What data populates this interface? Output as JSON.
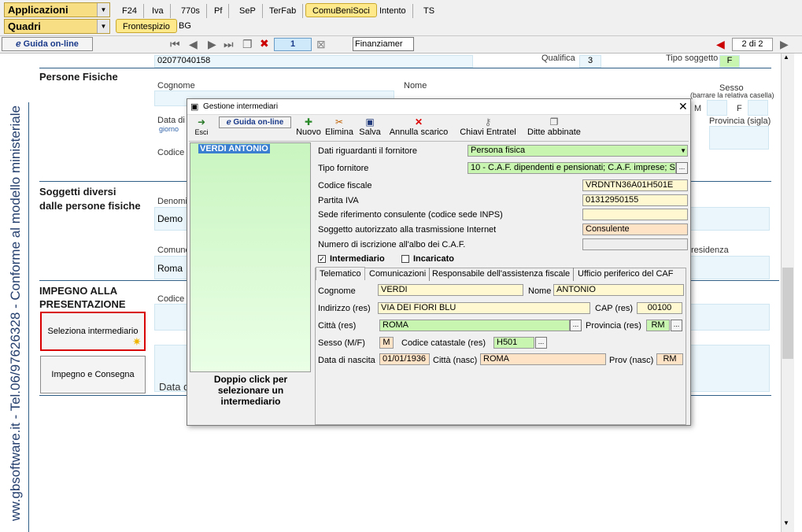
{
  "top": {
    "app_combo": "Applicazioni",
    "quadri_combo": "Quadri",
    "tabs": [
      "F24",
      "Iva",
      "770s",
      "Pf",
      "SeP",
      "TerFab",
      "ComuBeniSoci",
      "Intento",
      "TS"
    ],
    "subtabs": [
      "Frontespizio",
      "BG"
    ]
  },
  "nav": {
    "guida": "Guida on-line",
    "page_num": "1",
    "combo": "Finanziamer",
    "page_of": "2 di 2"
  },
  "form": {
    "vertical_text": "ww.gbsoftware.it - Tel.06/97626328 - Conforme al modello ministeriale",
    "codice_fiscale_val": "02077040158",
    "qualifica_lbl": "Qualifica",
    "qualifica_val": "3",
    "tipo_soggetto_lbl": "Tipo soggetto",
    "tipo_soggetto_val": "F",
    "persone_fisiche": "Persone Fisiche",
    "cognome": "Cognome",
    "nome": "Nome",
    "sesso": "Sesso",
    "sesso_hint": "(barrare la relativa casella)",
    "m": "M",
    "f": "F",
    "data_di": "Data di",
    "giorno": "giorno",
    "provincia_sigla": "Provincia (sigla)",
    "codice_s": "Codice S",
    "soggetti_diversi_1": "Soggetti diversi",
    "soggetti_diversi_2": "dalle persone fisiche",
    "denomin": "Denomin",
    "demo": "Demo",
    "comune": "Comune",
    "residenza": "residenza",
    "roma": "Roma",
    "impegno_1": "IMPEGNO ALLA",
    "impegno_2": "PRESENTAZIONE",
    "codice_f": "Codice F",
    "seleziona": "Seleziona intermediario",
    "impegno_consegna": "Impegno e Consegna",
    "data_c": "Data d"
  },
  "dialog": {
    "title": "Gestione intermediari",
    "toolbar": {
      "esci": "Esci",
      "guida": "Guida on-line",
      "nuovo": "Nuovo",
      "elimina": "Elimina",
      "salva": "Salva",
      "annulla": "Annulla scarico",
      "chiavi": "Chiavi Entratel",
      "ditte": "Ditte abbinate"
    },
    "list_item": "VERDI ANTONIO",
    "list_hint": "Doppio click per selezionare un intermediario",
    "fields": {
      "dati_fornitore_lbl": "Dati riguardanti il fornitore",
      "dati_fornitore_val": "Persona fisica",
      "tipo_fornitore_lbl": "Tipo fornitore",
      "tipo_fornitore_val": "10 - C.A.F. dipendenti e pensionati; C.A.F. imprese; S",
      "cf_lbl": "Codice fiscale",
      "cf_val": "VRDNTN36A01H501E",
      "piva_lbl": "Partita IVA",
      "piva_val": "01312950155",
      "sede_lbl": "Sede riferimento consulente (codice sede INPS)",
      "sede_val": "",
      "soggetto_lbl": "Soggetto autorizzato alla trasmissione Internet",
      "soggetto_val": "Consulente",
      "numero_lbl": "Numero di iscrizione all'albo dei C.A.F.",
      "numero_val": "",
      "intermediario_lbl": "Intermediario",
      "incaricato_lbl": "Incaricato"
    },
    "tabs": [
      "Telematico",
      "Comunicazioni",
      "Responsabile dell'assistenza fiscale",
      "Ufficio periferico del CAF"
    ],
    "tele": {
      "cognome_lbl": "Cognome",
      "cognome_val": "VERDI",
      "nome_lbl": "Nome",
      "nome_val": "ANTONIO",
      "indirizzo_lbl": "Indirizzo (res)",
      "indirizzo_val": "VIA DEI FIORI BLU",
      "cap_lbl": "CAP (res)",
      "cap_val": "00100",
      "citta_lbl": "Città (res)",
      "citta_val": "ROMA",
      "provincia_lbl": "Provincia (res)",
      "provincia_val": "RM",
      "sesso_lbl": "Sesso (M/F)",
      "sesso_val": "M",
      "catastale_lbl": "Codice catastale (res)",
      "catastale_val": "H501",
      "nascita_lbl": "Data di nascita",
      "nascita_val": "01/01/1936",
      "citta_nasc_lbl": "Città (nasc)",
      "citta_nasc_val": "ROMA",
      "prov_nasc_lbl": "Prov (nasc)",
      "prov_nasc_val": "RM"
    }
  }
}
